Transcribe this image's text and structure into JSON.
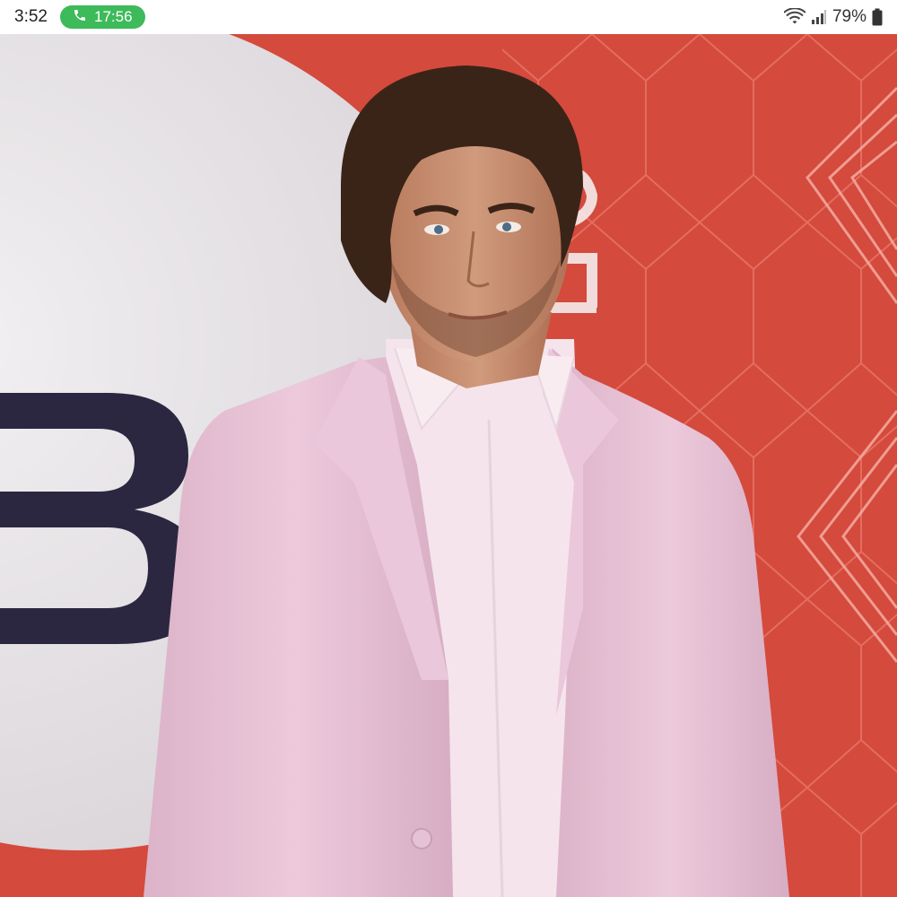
{
  "status_bar": {
    "time": "3:52",
    "call_duration": "17:56",
    "battery": "79%",
    "icons": {
      "call": "phone-icon",
      "wifi": "wifi-icon",
      "signal": "cell-signal-icon",
      "battery": "battery-icon"
    }
  },
  "photo": {
    "backdrop_logo_text": "BS",
    "colors": {
      "backdrop_red": "#d44a3c",
      "backdrop_white": "#e9e6e8",
      "suit_pink": "#e7c3d6",
      "shirt": "#f6e6ee",
      "hair": "#3a2418",
      "skin": "#c98c6d"
    }
  },
  "theme": {
    "call_pill_color": "#3dba5a"
  }
}
